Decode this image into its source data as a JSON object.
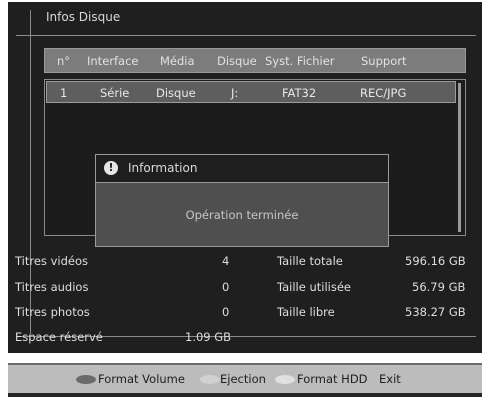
{
  "title": "Infos Disque",
  "table": {
    "headers": [
      "n°",
      "Interface",
      "Média",
      "Disque",
      "Syst. Fichier",
      "Support"
    ],
    "rows": [
      [
        "1",
        "Série",
        "Disque",
        "J:",
        "FAT32",
        "REC/JPG"
      ]
    ]
  },
  "dialog": {
    "title": "Information",
    "message": "Opération terminée"
  },
  "stats": {
    "videos_label": "Titres vidéos",
    "videos_value": "4",
    "audios_label": "Titres audios",
    "audios_value": "0",
    "photos_label": "Titres photos",
    "photos_value": "0",
    "reserved_label": "Espace réservé",
    "reserved_value": "1.09 GB",
    "total_label": "Taille totale",
    "total_value": "596.16 GB",
    "used_label": "Taille utilisée",
    "used_value": "56.79 GB",
    "free_label": "Taille libre",
    "free_value": "538.27 GB"
  },
  "footer": {
    "format_volume": "Format Volume",
    "ejection": "Ejection",
    "format_hdd": "Format HDD",
    "exit": "Exit",
    "colors": {
      "red": "#6a6a6a",
      "green": "#d0d0d0",
      "yellow": "#e0e0e0",
      "blue": "#a8a8a8"
    }
  }
}
